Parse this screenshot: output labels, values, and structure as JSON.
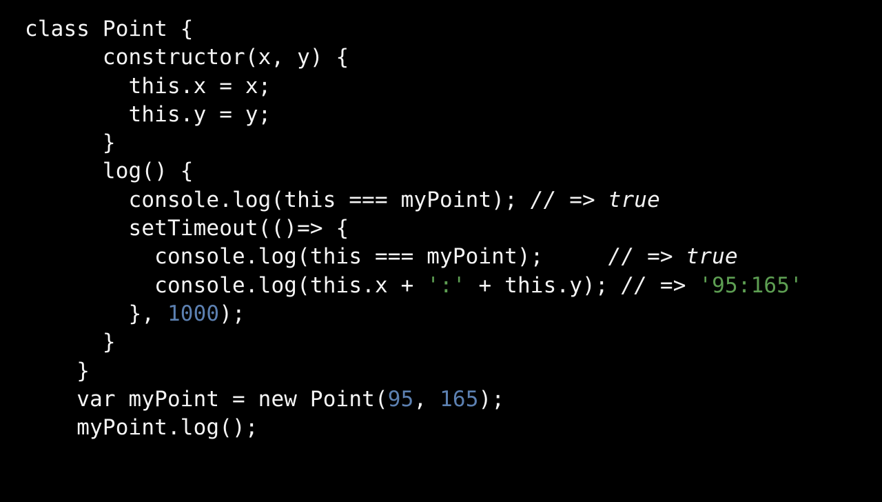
{
  "editor": {
    "background_color": "#000000",
    "default_text_color": "#f5f5f5",
    "string_color": "#5d9e52",
    "number_color": "#5c80b1",
    "comment_color": "#f2f2f2",
    "language": "javascript",
    "font_size_px": 31,
    "line_height_px": 41
  },
  "code": {
    "lines": [
      {
        "index": 1,
        "tokens": [
          {
            "type": "plain",
            "text": "class Point {"
          }
        ]
      },
      {
        "index": 2,
        "tokens": [
          {
            "type": "plain",
            "text": "      constructor(x, y) {"
          }
        ]
      },
      {
        "index": 3,
        "tokens": [
          {
            "type": "plain",
            "text": "        this.x = x;"
          }
        ]
      },
      {
        "index": 4,
        "tokens": [
          {
            "type": "plain",
            "text": "        this.y = y;"
          }
        ]
      },
      {
        "index": 5,
        "tokens": [
          {
            "type": "plain",
            "text": "      }"
          }
        ]
      },
      {
        "index": 6,
        "tokens": [
          {
            "type": "plain",
            "text": "      log() {"
          }
        ]
      },
      {
        "index": 7,
        "tokens": [
          {
            "type": "plain",
            "text": "        console.log(this === myPoint); "
          },
          {
            "type": "comment",
            "text": "// => true"
          }
        ]
      },
      {
        "index": 8,
        "tokens": [
          {
            "type": "plain",
            "text": "        setTimeout(()=> {"
          }
        ]
      },
      {
        "index": 9,
        "tokens": [
          {
            "type": "plain",
            "text": "          console.log(this === myPoint);     "
          },
          {
            "type": "comment",
            "text": "// => true"
          }
        ]
      },
      {
        "index": 10,
        "tokens": [
          {
            "type": "plain",
            "text": "          console.log(this.x + "
          },
          {
            "type": "string",
            "text": "':'"
          },
          {
            "type": "plain",
            "text": " + this.y); "
          },
          {
            "type": "comment",
            "text": "// => "
          },
          {
            "type": "string",
            "text": "'95:165'"
          }
        ]
      },
      {
        "index": 11,
        "tokens": [
          {
            "type": "plain",
            "text": "        }, "
          },
          {
            "type": "number",
            "text": "1000"
          },
          {
            "type": "plain",
            "text": ");"
          }
        ]
      },
      {
        "index": 12,
        "tokens": [
          {
            "type": "plain",
            "text": "      }"
          }
        ]
      },
      {
        "index": 13,
        "tokens": [
          {
            "type": "plain",
            "text": "    }"
          }
        ]
      },
      {
        "index": 14,
        "tokens": [
          {
            "type": "plain",
            "text": "    var myPoint = new Point("
          },
          {
            "type": "number",
            "text": "95"
          },
          {
            "type": "plain",
            "text": ", "
          },
          {
            "type": "number",
            "text": "165"
          },
          {
            "type": "plain",
            "text": ");"
          }
        ]
      },
      {
        "index": 15,
        "tokens": [
          {
            "type": "plain",
            "text": "    myPoint.log();"
          }
        ]
      }
    ]
  }
}
